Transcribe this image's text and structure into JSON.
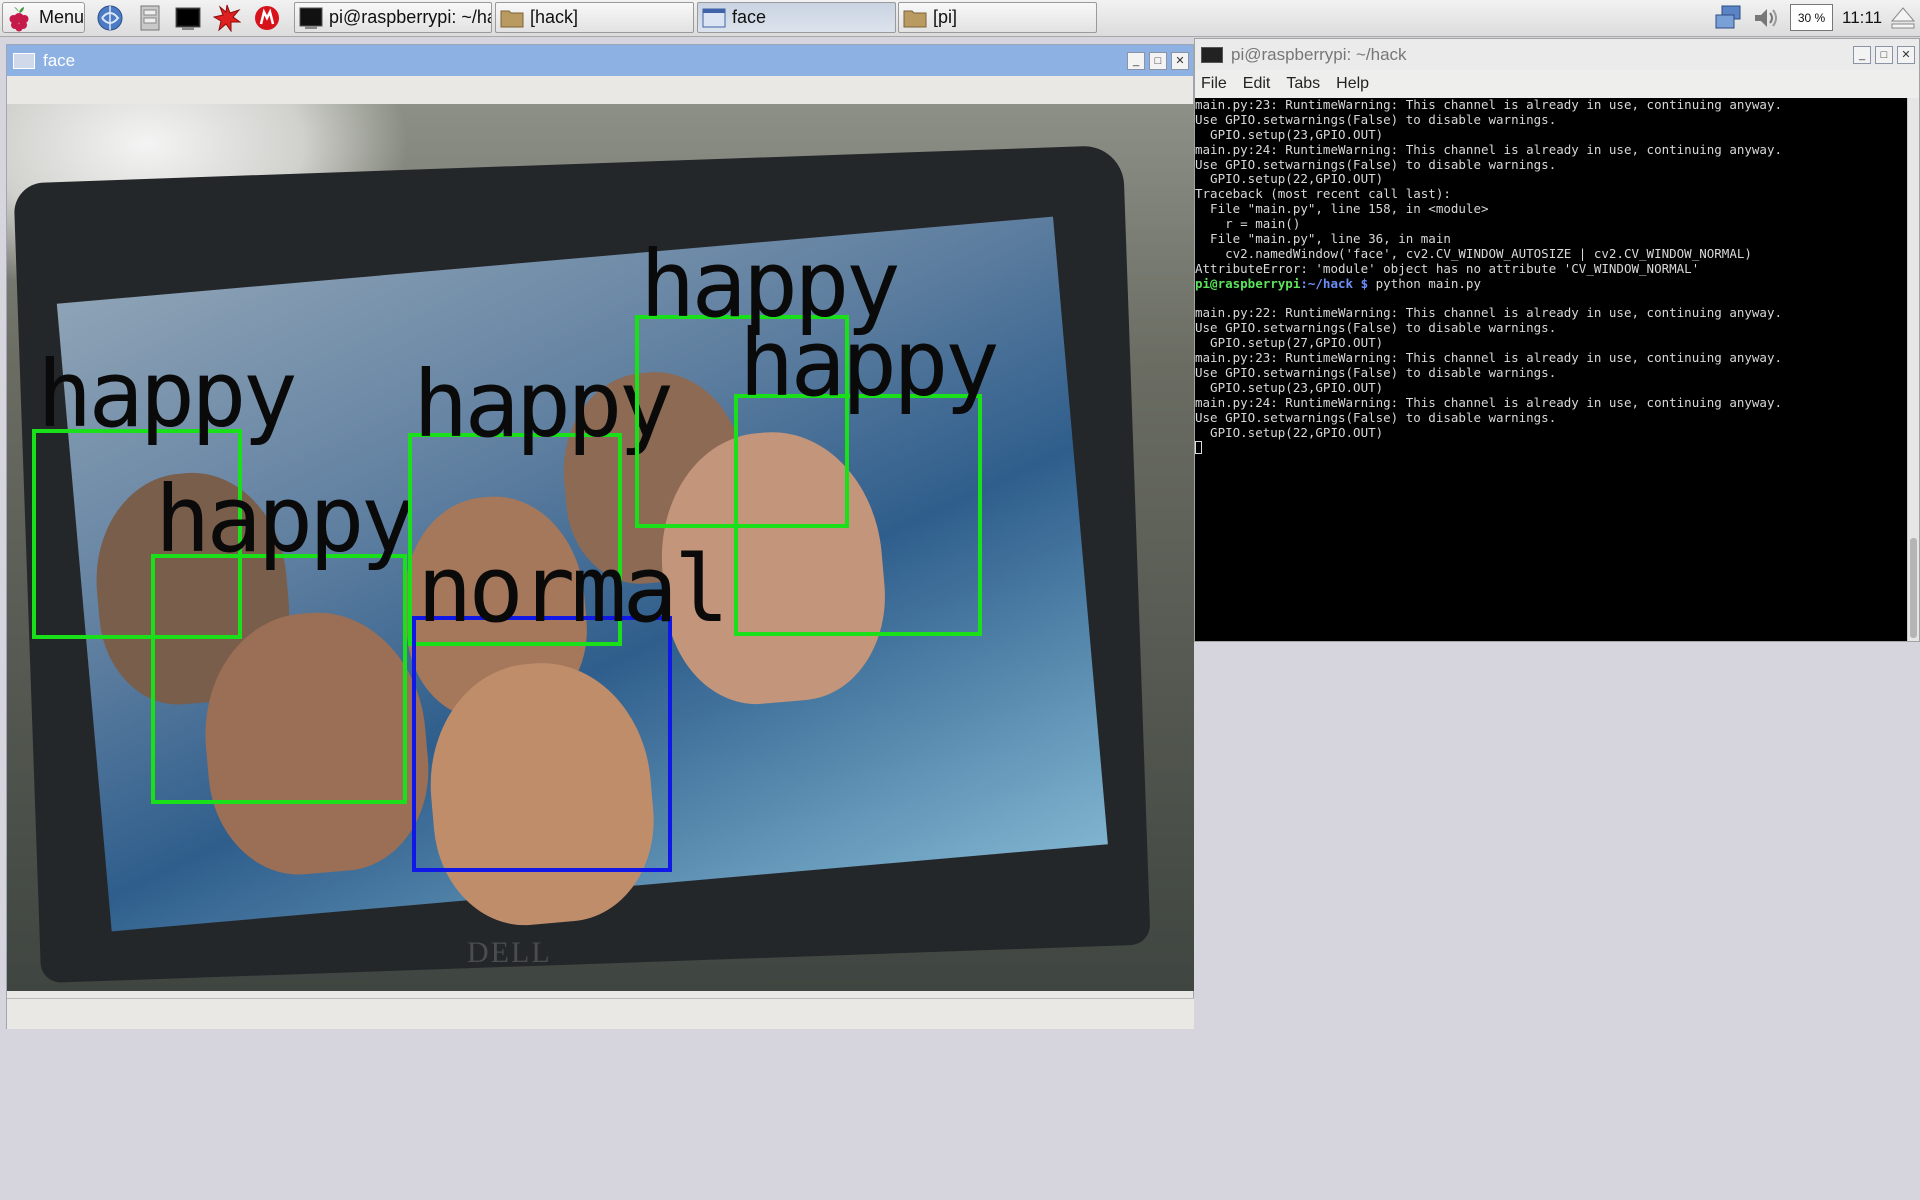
{
  "taskbar": {
    "menu_label": "Menu",
    "launchers": [
      "browser-icon",
      "file-manager-icon",
      "terminal-icon",
      "mathematica-icon",
      "wolfram-icon"
    ],
    "tasks": [
      {
        "label": "pi@raspberrypi: ~/ha...",
        "icon": "terminal-icon"
      },
      {
        "label": "[hack]",
        "icon": "folder-icon"
      },
      {
        "label": "face",
        "icon": "window-icon"
      },
      {
        "label": "[pi]",
        "icon": "folder-icon"
      }
    ],
    "cpu_label": "30 %",
    "clock": "11:11"
  },
  "face_window": {
    "title": "face",
    "detections": [
      {
        "label": "happy",
        "color": "#1ae01a"
      },
      {
        "label": "happy",
        "color": "#1ae01a"
      },
      {
        "label": "happy",
        "color": "#1ae01a"
      },
      {
        "label": "happy",
        "color": "#1ae01a"
      },
      {
        "label": "happy",
        "color": "#1ae01a"
      },
      {
        "label": "normal",
        "color": "#1018e8"
      }
    ]
  },
  "terminal_window": {
    "title": "pi@raspberrypi: ~/hack",
    "menu": [
      "File",
      "Edit",
      "Tabs",
      "Help"
    ],
    "lines": [
      "main.py:23: RuntimeWarning: This channel is already in use, continuing anyway.",
      "Use GPIO.setwarnings(False) to disable warnings.",
      "  GPIO.setup(23,GPIO.OUT)",
      "main.py:24: RuntimeWarning: This channel is already in use, continuing anyway.",
      "Use GPIO.setwarnings(False) to disable warnings.",
      "  GPIO.setup(22,GPIO.OUT)",
      "Traceback (most recent call last):",
      "  File \"main.py\", line 158, in <module>",
      "    r = main()",
      "  File \"main.py\", line 36, in main",
      "    cv2.namedWindow('face', cv2.CV_WINDOW_AUTOSIZE | cv2.CV_WINDOW_NORMAL)",
      "AttributeError: 'module' object has no attribute 'CV_WINDOW_NORMAL'"
    ],
    "prompt_user": "pi@raspberrypi",
    "prompt_path": ":~/hack $",
    "command": " python main.py",
    "lines_after": [
      "",
      "main.py:22: RuntimeWarning: This channel is already in use, continuing anyway.",
      "Use GPIO.setwarnings(False) to disable warnings.",
      "  GPIO.setup(27,GPIO.OUT)",
      "main.py:23: RuntimeWarning: This channel is already in use, continuing anyway.",
      "Use GPIO.setwarnings(False) to disable warnings.",
      "  GPIO.setup(23,GPIO.OUT)",
      "main.py:24: RuntimeWarning: This channel is already in use, continuing anyway.",
      "Use GPIO.setwarnings(False) to disable warnings.",
      "  GPIO.setup(22,GPIO.OUT)"
    ]
  }
}
